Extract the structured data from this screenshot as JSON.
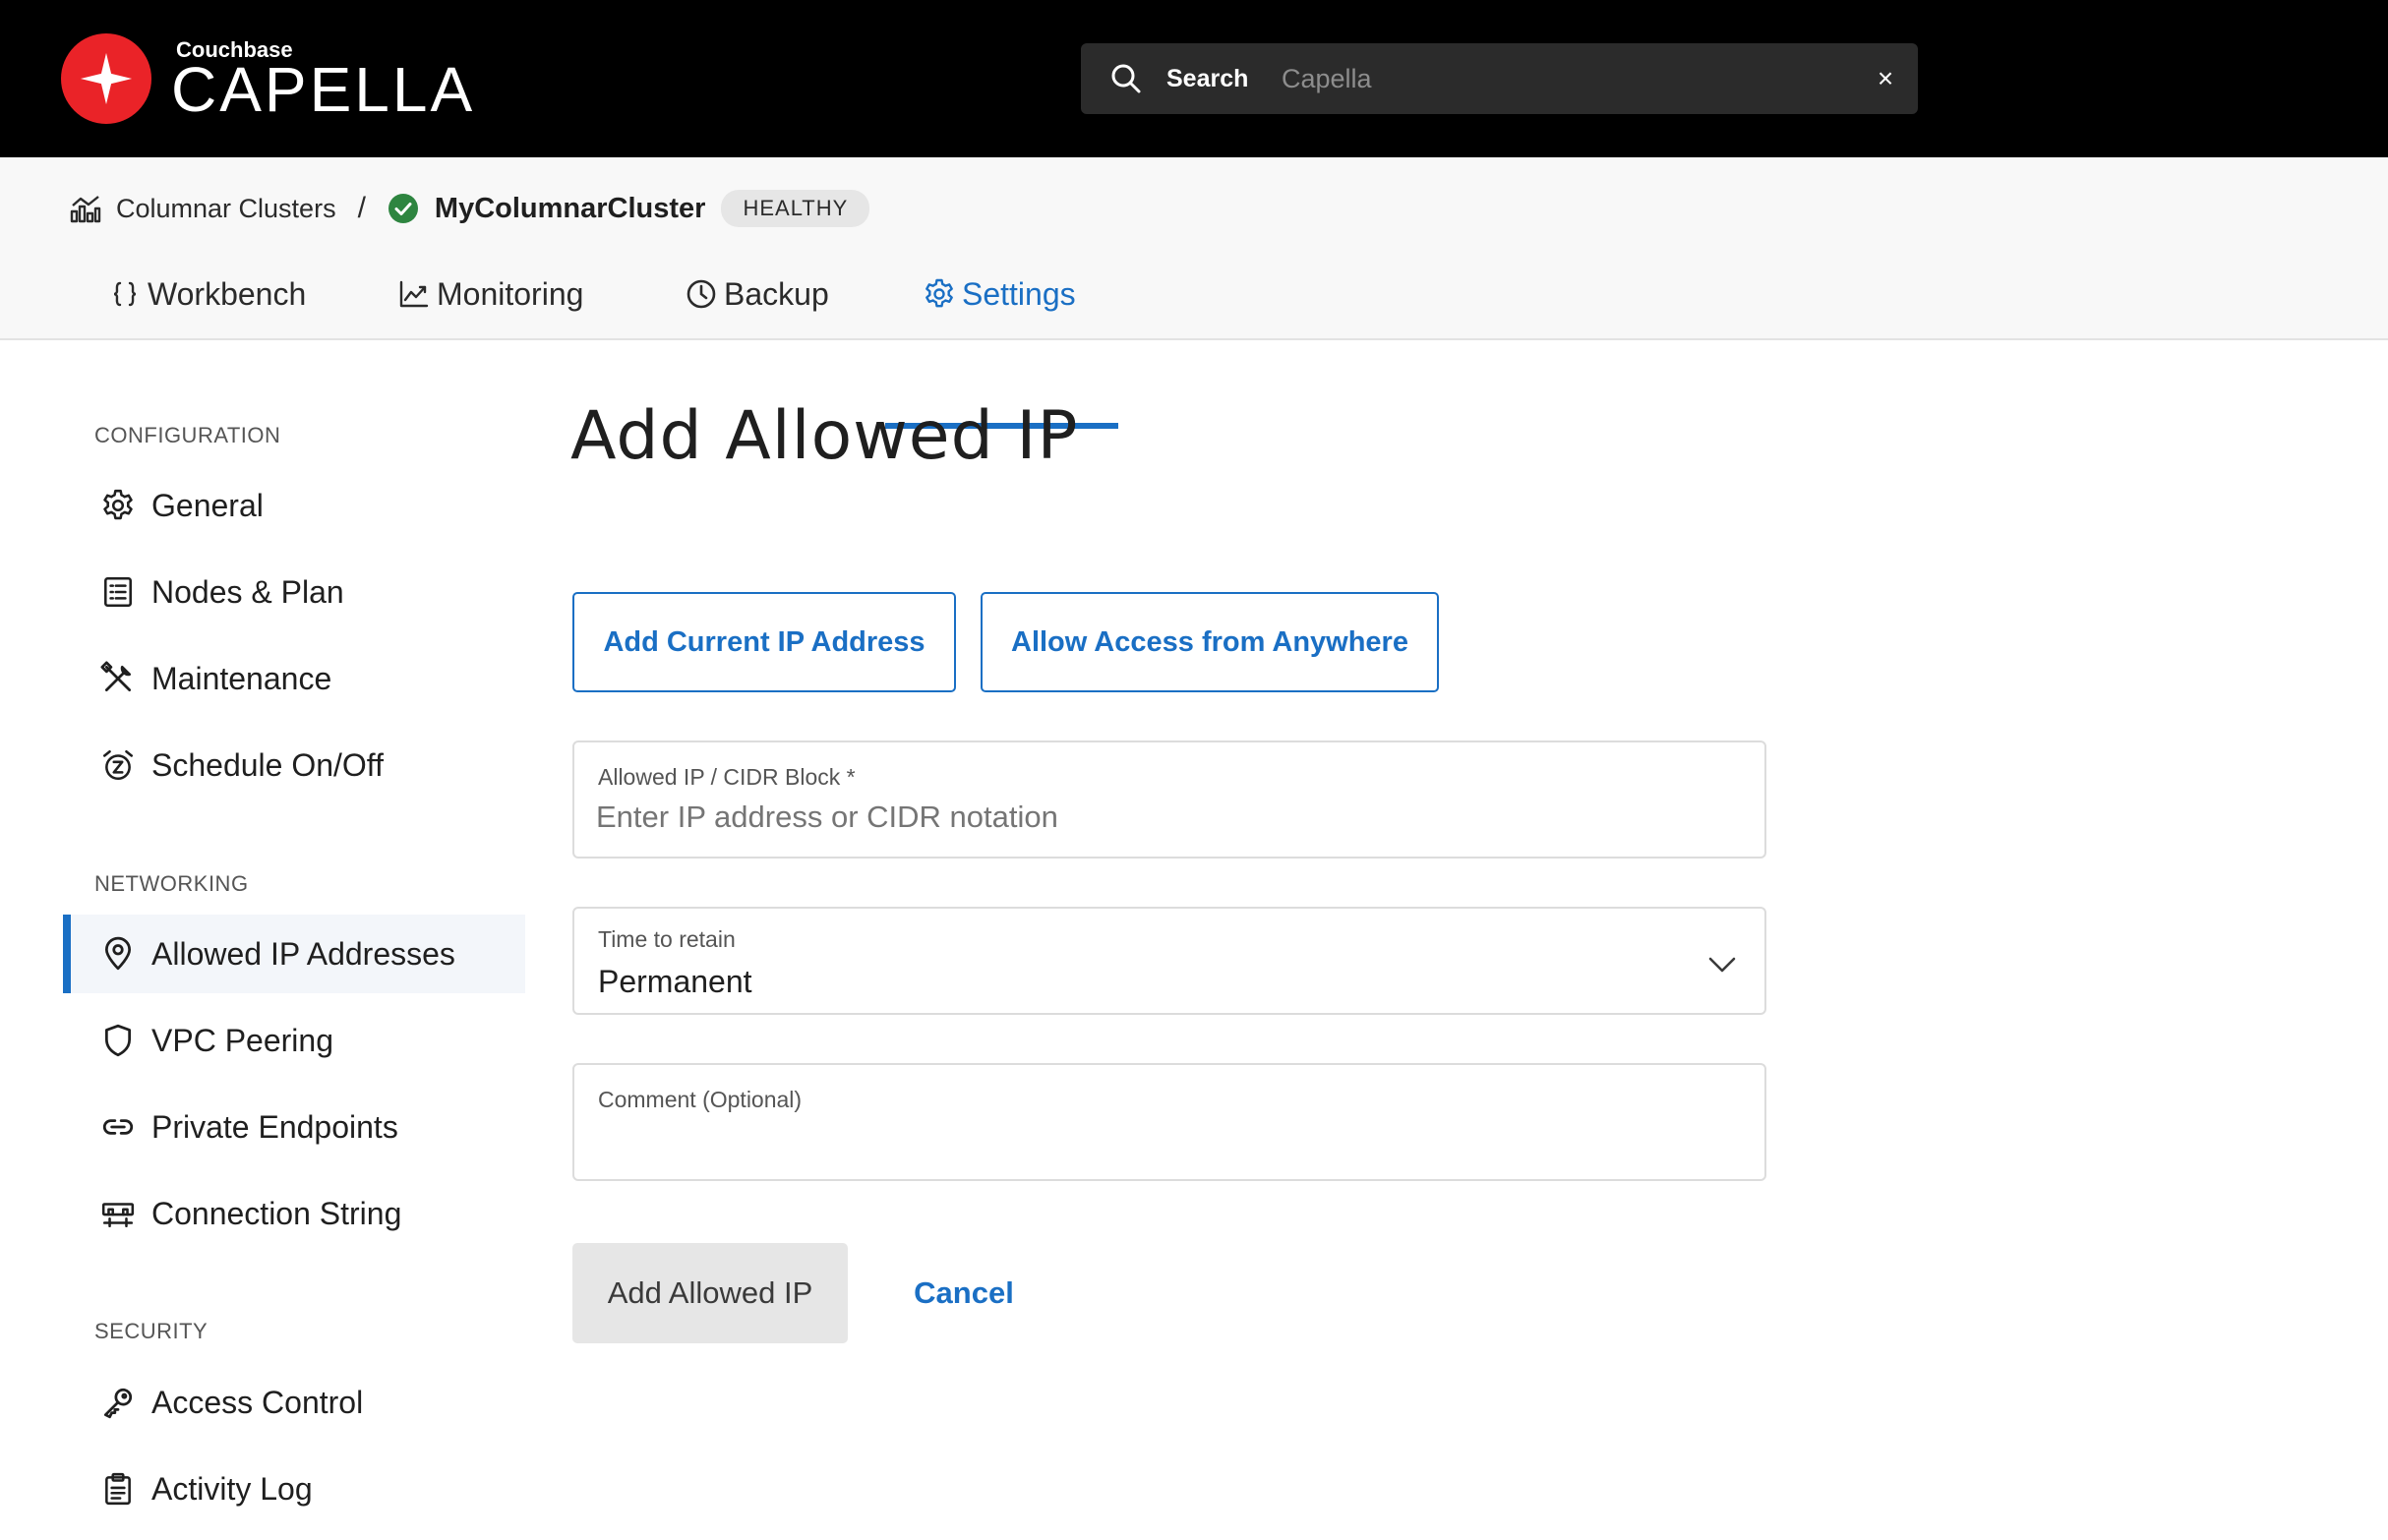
{
  "brand": {
    "company": "Couchbase",
    "product": "CAPELLA"
  },
  "search": {
    "label": "Search",
    "placeholder": "Capella",
    "clear": "×"
  },
  "breadcrumb": {
    "parent": "Columnar Clusters",
    "separator": "/",
    "current": "MyColumnarCluster",
    "status": "HEALTHY"
  },
  "tabs": [
    {
      "label": "Workbench"
    },
    {
      "label": "Monitoring"
    },
    {
      "label": "Backup"
    },
    {
      "label": "Settings"
    }
  ],
  "sidebar": {
    "sections": [
      {
        "title": "CONFIGURATION",
        "items": [
          "General",
          "Nodes & Plan",
          "Maintenance",
          "Schedule On/Off"
        ]
      },
      {
        "title": "NETWORKING",
        "items": [
          "Allowed IP Addresses",
          "VPC Peering",
          "Private Endpoints",
          "Connection String"
        ]
      },
      {
        "title": "SECURITY",
        "items": [
          "Access Control",
          "Activity Log"
        ]
      }
    ]
  },
  "main": {
    "title": "Add Allowed IP",
    "add_current_ip": "Add Current IP Address",
    "allow_anywhere": "Allow Access from Anywhere",
    "ip_field": {
      "label": "Allowed IP / CIDR Block *",
      "placeholder": "Enter IP address or CIDR notation"
    },
    "retain_field": {
      "label": "Time to retain",
      "value": "Permanent"
    },
    "comment_field": {
      "label": "Comment (Optional)"
    },
    "submit": "Add Allowed IP",
    "cancel": "Cancel"
  },
  "colors": {
    "accent": "#1a6fc4",
    "brand_red": "#ea2328",
    "healthy": "#2e8540"
  }
}
